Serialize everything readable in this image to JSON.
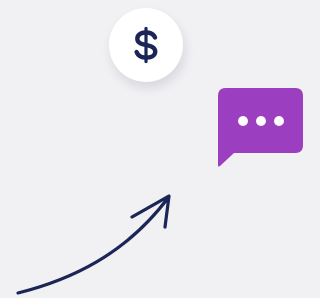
{
  "colors": {
    "background": "#f1f0f3",
    "badge": "#ffffff",
    "dollar": "#1b2556",
    "chat_bubble": "#9b3fc0",
    "chat_dots": "#ffffff",
    "arrow": "#1b2556"
  },
  "icons": {
    "badge": "dollar-icon",
    "bubble": "chat-bubble-icon",
    "arrow": "curved-arrow-icon"
  }
}
